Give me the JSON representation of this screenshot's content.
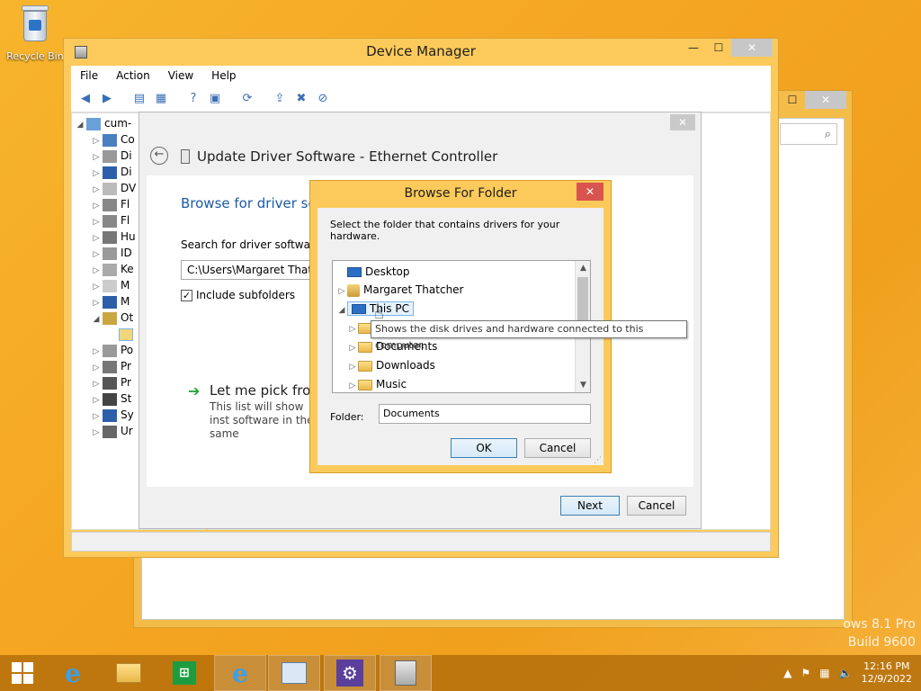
{
  "desktop": {
    "recycle_label": "Recycle Bin"
  },
  "device_manager": {
    "title": "Device Manager",
    "menu": [
      "File",
      "Action",
      "View",
      "Help"
    ],
    "tree_root": "cum-",
    "tree_items": [
      "Co",
      "Di",
      "Di",
      "DV",
      "Fl",
      "Fl",
      "Hu",
      "ID",
      "Ke",
      "M",
      "M",
      "Ot",
      "",
      "Po",
      "Pr",
      "Pr",
      "St",
      "Sy",
      "Ur"
    ]
  },
  "update_driver": {
    "header": "Update Driver Software - Ethernet Controller",
    "heading": "Browse for driver sof",
    "search_label": "Search for driver software ir",
    "path": "C:\\Users\\Margaret Thatche",
    "include_subfolders": "Include subfolders",
    "pick_title": "Let me pick from",
    "pick_desc": "This list will show inst software in the same",
    "next": "Next",
    "cancel": "Cancel"
  },
  "browse_folder": {
    "title": "Browse For Folder",
    "instruction": "Select the folder that contains drivers for your hardware.",
    "items": [
      {
        "label": "Desktop",
        "icon": "desktop-icon"
      },
      {
        "label": "Margaret Thatcher",
        "icon": "user-folder-icon"
      },
      {
        "label": "This PC",
        "icon": "computer-icon"
      },
      {
        "label": "",
        "icon": "folder-icon"
      },
      {
        "label": "Documents",
        "icon": "folder-icon"
      },
      {
        "label": "Downloads",
        "icon": "folder-icon"
      },
      {
        "label": "Music",
        "icon": "folder-icon"
      }
    ],
    "folder_label": "Folder:",
    "folder_value": "Documents",
    "ok": "OK",
    "cancel": "Cancel",
    "close": "✕"
  },
  "tooltip": "Shows the disk drives and hardware connected to this computer.",
  "watermark": {
    "line1": "ows 8.1 Pro",
    "line2": "Build 9600"
  },
  "taskbar": {
    "time": "12:16 PM",
    "date": "12/9/2022"
  },
  "colors": {
    "accent": "#f5a623",
    "close_red": "#d9534f",
    "link_blue": "#1c5aa6"
  }
}
